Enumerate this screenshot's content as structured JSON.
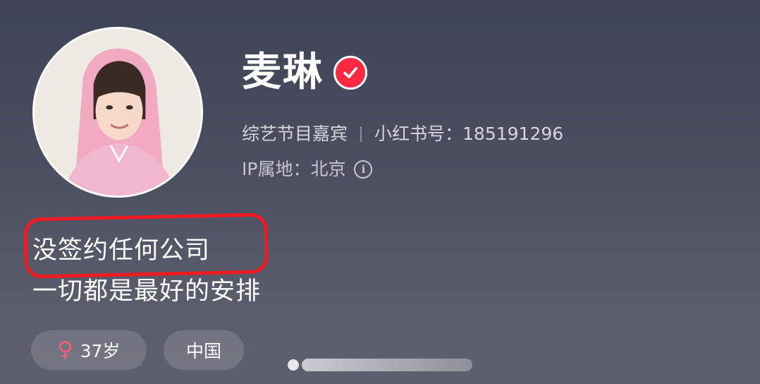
{
  "profile": {
    "name": "麦琳",
    "role": "综艺节目嘉宾",
    "account": "小红书号：185191296",
    "ip_location": "IP属地：北京",
    "info_icon_glyph": "i",
    "verified_icon": "check-icon",
    "verified_color": "#ff2a42"
  },
  "bio": {
    "line1": "没签约任何公司",
    "line2": "一切都是最好的安排",
    "highlight_color": "#ee1b23"
  },
  "tags": {
    "gender_symbol": "♀",
    "age": "37岁",
    "country": "中国"
  }
}
